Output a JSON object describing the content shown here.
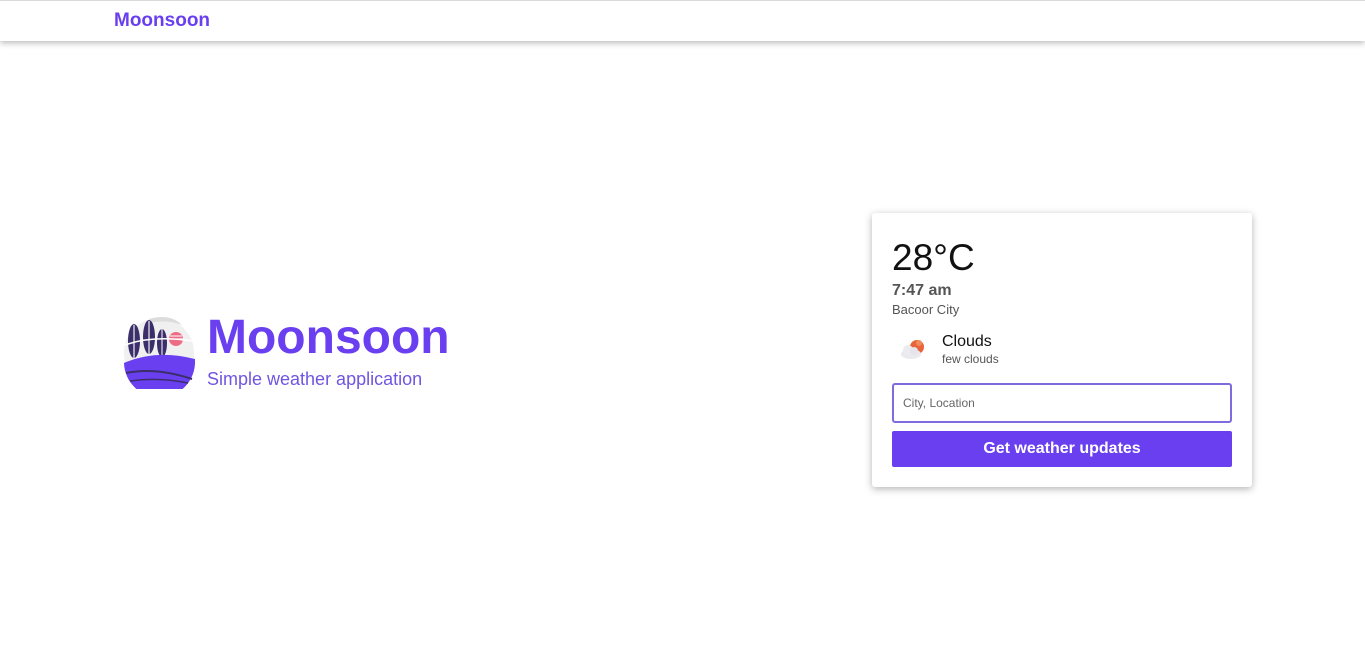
{
  "navbar": {
    "brand": "Moonsoon"
  },
  "hero": {
    "title": "Moonsoon",
    "subtitle": "Simple weather application",
    "logo_icon": "moonsoon-logo-icon"
  },
  "weather": {
    "temperature": "28°C",
    "time": "7:47 am",
    "city": "Bacoor City",
    "condition": "Clouds",
    "description": "few clouds",
    "condition_icon": "few-clouds-icon"
  },
  "search": {
    "placeholder": "City, Location",
    "value": ""
  },
  "actions": {
    "submit_label": "Get weather updates"
  },
  "colors": {
    "brand": "#6a3ff0",
    "subtitle": "#7155e0",
    "input_border": "#7d6be0",
    "sun": "#e8643c"
  }
}
